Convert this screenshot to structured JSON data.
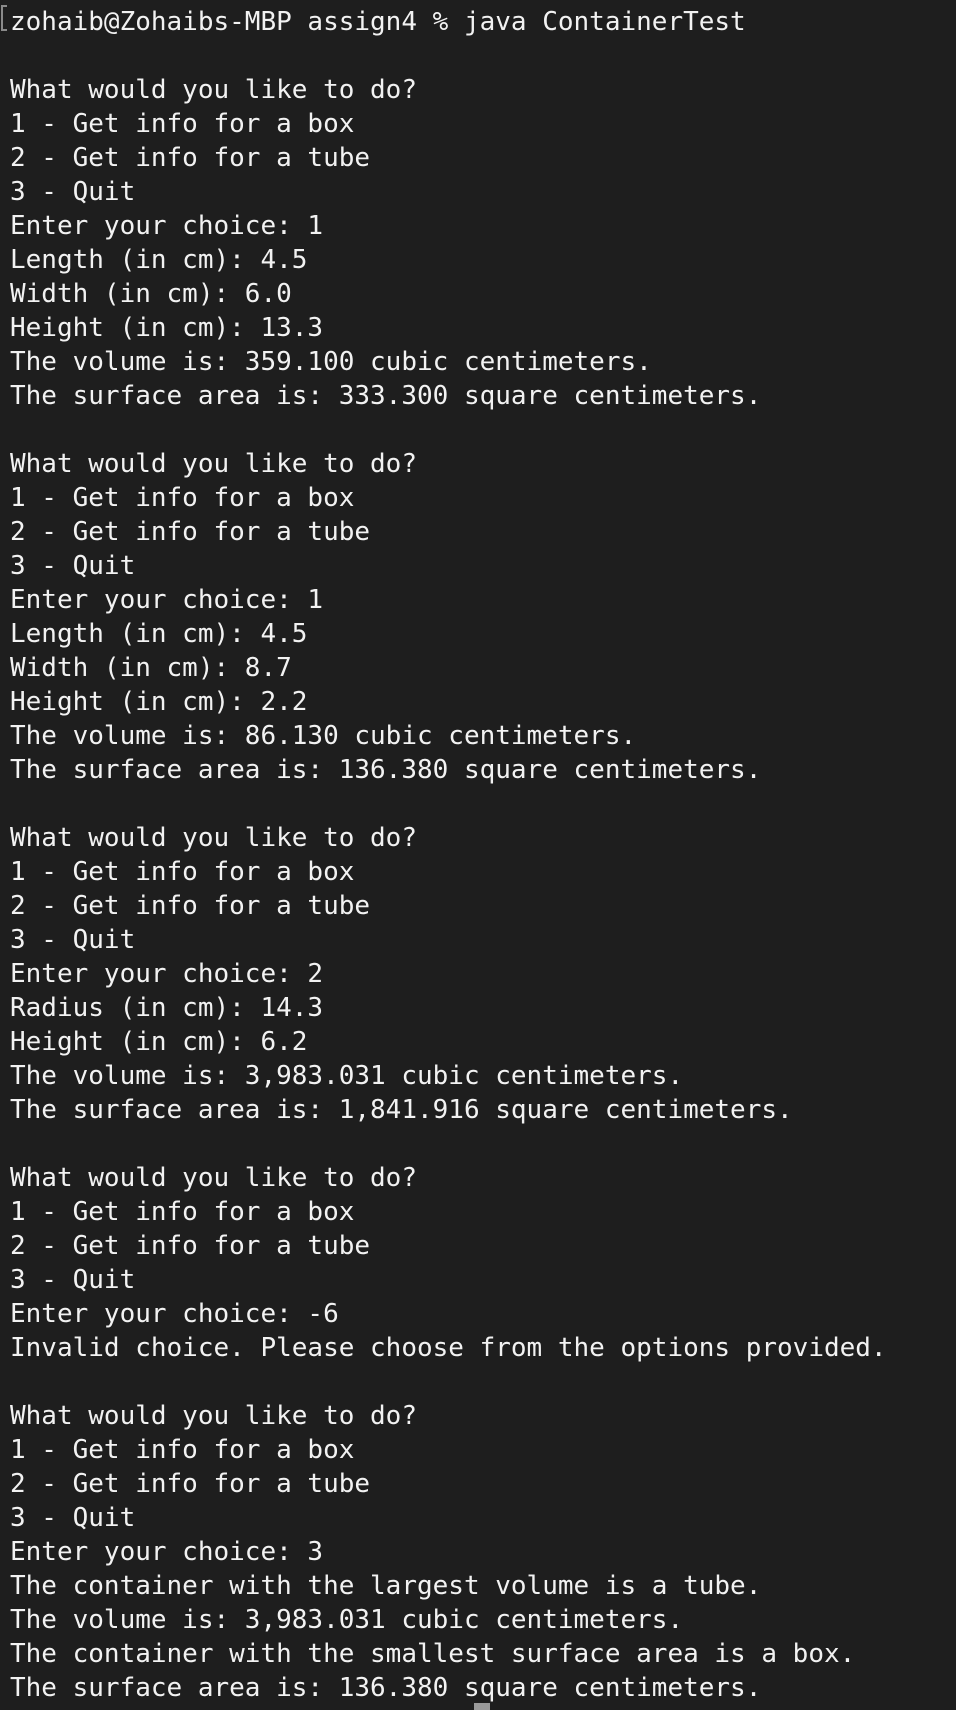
{
  "terminal": {
    "lines": [
      "zohaib@Zohaibs-MBP assign4 % java ContainerTest",
      "",
      "What would you like to do?",
      "1 - Get info for a box",
      "2 - Get info for a tube",
      "3 - Quit",
      "Enter your choice: 1",
      "Length (in cm): 4.5",
      "Width (in cm): 6.0",
      "Height (in cm): 13.3",
      "The volume is: 359.100 cubic centimeters.",
      "The surface area is: 333.300 square centimeters.",
      "",
      "What would you like to do?",
      "1 - Get info for a box",
      "2 - Get info for a tube",
      "3 - Quit",
      "Enter your choice: 1",
      "Length (in cm): 4.5",
      "Width (in cm): 8.7",
      "Height (in cm): 2.2",
      "The volume is: 86.130 cubic centimeters.",
      "The surface area is: 136.380 square centimeters.",
      "",
      "What would you like to do?",
      "1 - Get info for a box",
      "2 - Get info for a tube",
      "3 - Quit",
      "Enter your choice: 2",
      "Radius (in cm): 14.3",
      "Height (in cm): 6.2",
      "The volume is: 3,983.031 cubic centimeters.",
      "The surface area is: 1,841.916 square centimeters.",
      "",
      "What would you like to do?",
      "1 - Get info for a box",
      "2 - Get info for a tube",
      "3 - Quit",
      "Enter your choice: -6",
      "Invalid choice. Please choose from the options provided.",
      "",
      "What would you like to do?",
      "1 - Get info for a box",
      "2 - Get info for a tube",
      "3 - Quit",
      "Enter your choice: 3",
      "The container with the largest volume is a tube.",
      "The volume is: 3,983.031 cubic centimeters.",
      "The container with the smallest surface area is a box.",
      "The surface area is: 136.380 square centimeters."
    ],
    "colors": {
      "background": "#1e1e1e",
      "text": "#f2f2f2"
    }
  }
}
